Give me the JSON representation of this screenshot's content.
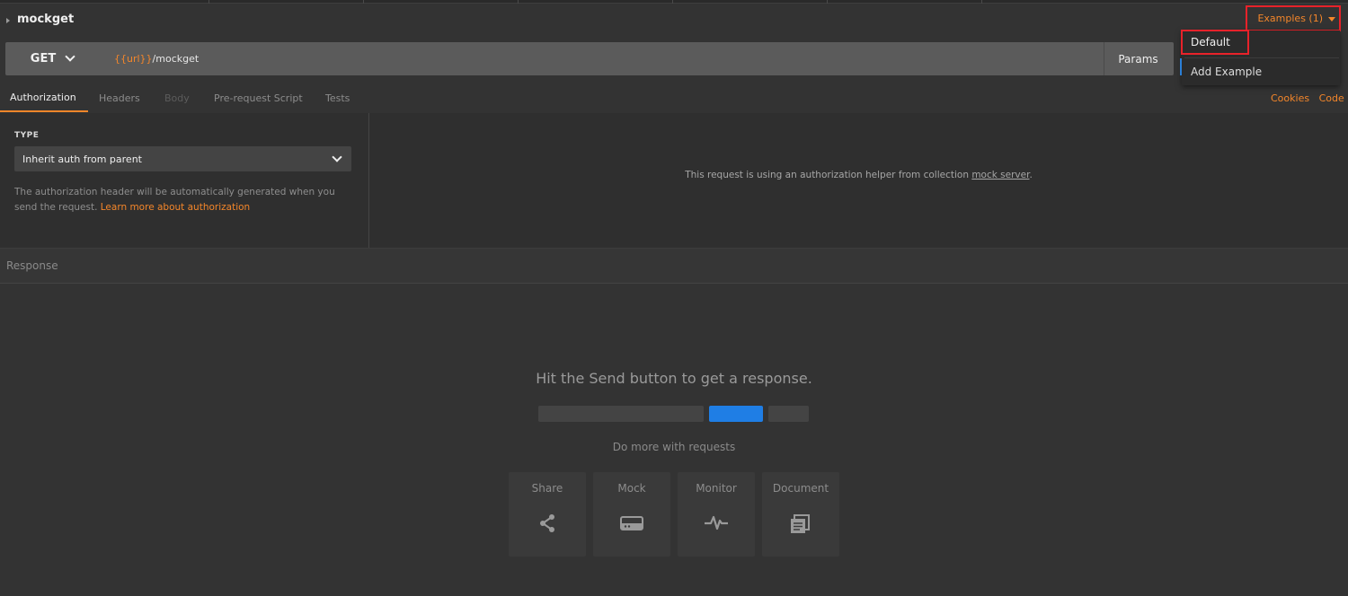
{
  "request": {
    "name": "mockget",
    "method": "GET",
    "url_variable": "{{url}}",
    "url_path": "/mockget",
    "params_label": "Params"
  },
  "examples": {
    "button_label": "Examples (1)",
    "menu": {
      "default_label": "Default",
      "add_label": "Add Example"
    }
  },
  "tabs": [
    {
      "label": "Authorization",
      "state": "active"
    },
    {
      "label": "Headers",
      "state": "normal"
    },
    {
      "label": "Body",
      "state": "disabled"
    },
    {
      "label": "Pre-request Script",
      "state": "normal"
    },
    {
      "label": "Tests",
      "state": "normal"
    }
  ],
  "links": {
    "cookies": "Cookies",
    "code": "Code"
  },
  "auth": {
    "type_label": "TYPE",
    "type_value": "Inherit auth from parent",
    "description": "The authorization header will be automatically generated when you send the request.",
    "learn_more": "Learn more about authorization",
    "helper_prefix": "This request is using an authorization helper from collection",
    "collection_name": "mock server",
    "helper_suffix": "."
  },
  "response": {
    "label": "Response",
    "hit_send": "Hit the Send button to get a response.",
    "do_more": "Do more with requests",
    "cards": [
      {
        "label": "Share",
        "icon": "share-icon"
      },
      {
        "label": "Mock",
        "icon": "mock-server-icon"
      },
      {
        "label": "Monitor",
        "icon": "monitor-pulse-icon"
      },
      {
        "label": "Document",
        "icon": "document-icon"
      }
    ]
  },
  "colors": {
    "accent": "#f4862a",
    "highlight": "#e8222a",
    "send_blue": "#1f7ee5",
    "background": "#333333"
  }
}
